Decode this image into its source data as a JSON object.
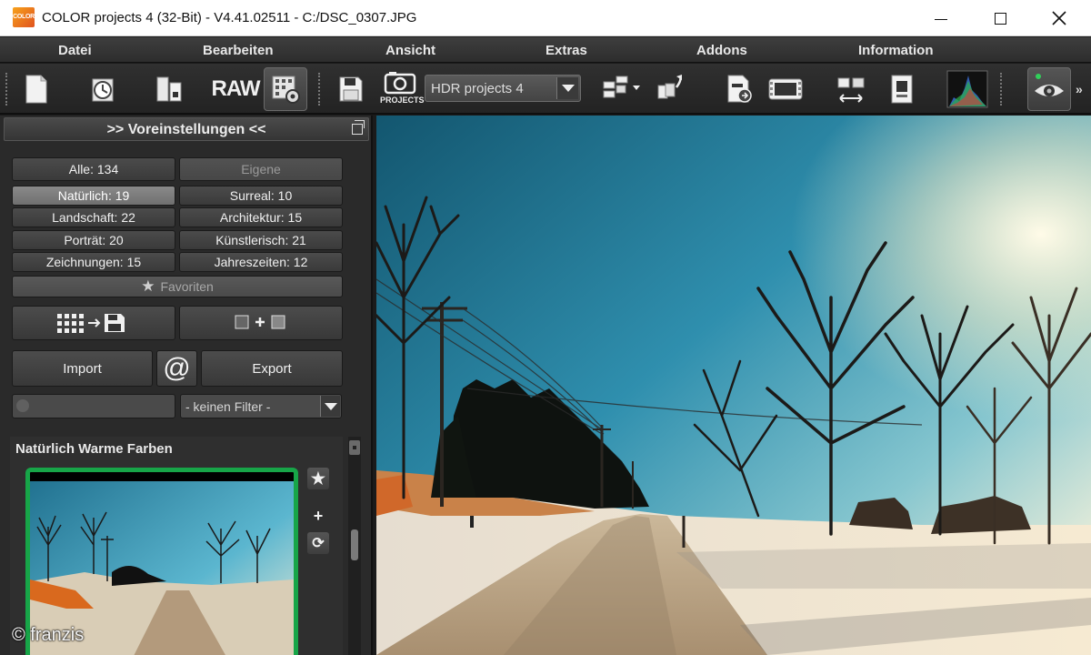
{
  "window": {
    "logo_text": "COLOR",
    "title": "COLOR projects 4 (32-Bit) - V4.41.02511 - C:/DSC_0307.JPG"
  },
  "menu": [
    "Datei",
    "Bearbeiten",
    "Ansicht",
    "Extras",
    "Addons",
    "Information"
  ],
  "toolbar": {
    "raw_label": "RAW",
    "projects_label": "PROJECTS",
    "preset_select_value": "HDR projects 4",
    "icons": [
      "new-document-icon",
      "history-icon",
      "open-file-icon",
      "raw-icon",
      "settings-grid-icon",
      "save-icon",
      "projects-icon",
      "batch-icon",
      "export-icon",
      "file-send-icon",
      "filmstrip-icon",
      "compare-icon",
      "info-document-icon",
      "histogram-icon",
      "preview-eye-icon"
    ]
  },
  "panel": {
    "title": ">> Voreinstellungen <<",
    "categories": [
      {
        "label": "Alle: 134",
        "state": "normal"
      },
      {
        "label": "Eigene",
        "state": "disabled"
      },
      {
        "label": "Natürlich: 19",
        "state": "selected"
      },
      {
        "label": "Surreal: 10",
        "state": "normal"
      },
      {
        "label": "Landschaft: 22",
        "state": "normal"
      },
      {
        "label": "Architektur: 15",
        "state": "normal"
      },
      {
        "label": "Porträt: 20",
        "state": "normal"
      },
      {
        "label": "Künstlerisch: 21",
        "state": "normal"
      },
      {
        "label": "Zeichnungen: 15",
        "state": "normal"
      },
      {
        "label": "Jahreszeiten: 12",
        "state": "normal"
      }
    ],
    "favorites_label": "Favoriten",
    "import_label": "Import",
    "at_label": "@",
    "export_label": "Export",
    "search_placeholder": "",
    "filter_value": "- keinen Filter -",
    "preset_name": "Natürlich Warme Farben",
    "accent_color": "#17a548"
  },
  "watermark": "© franzis"
}
